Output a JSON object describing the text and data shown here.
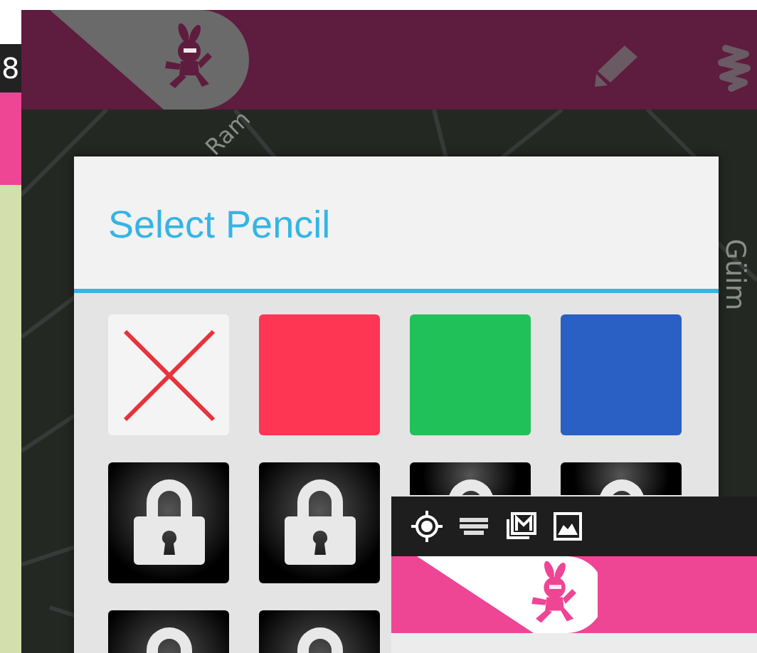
{
  "back_window": {
    "status_bar": {
      "time": "8"
    }
  },
  "main_window": {
    "map_labels": [
      {
        "text": "Ram",
        "kind": "diagonal"
      },
      {
        "text": "Güim",
        "kind": "vertical"
      }
    ],
    "dialog": {
      "title": "Select Pencil",
      "tiles": [
        {
          "kind": "none"
        },
        {
          "kind": "color",
          "color": "#fe3553"
        },
        {
          "kind": "color",
          "color": "#21c15a"
        },
        {
          "kind": "color",
          "color": "#2a5fc4"
        },
        {
          "kind": "locked"
        },
        {
          "kind": "locked"
        },
        {
          "kind": "locked"
        },
        {
          "kind": "locked"
        },
        {
          "kind": "locked"
        },
        {
          "kind": "locked"
        }
      ]
    }
  }
}
